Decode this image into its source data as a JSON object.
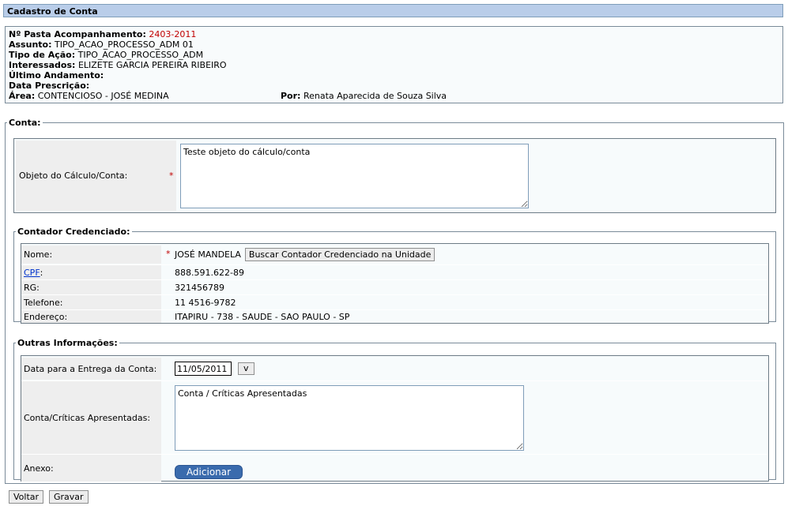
{
  "header": {
    "title": "Cadastro de Conta"
  },
  "info": {
    "pasta_label": "Nº Pasta Acompanhamento:",
    "pasta_value": "2403-2011",
    "assunto_label": "Assunto:",
    "assunto_value": "TIPO_ACAO_PROCESSO_ADM 01",
    "tipo_label": "Tipo de Ação:",
    "tipo_value": "TIPO_ACAO_PROCESSO_ADM",
    "interessados_label": "Interessados:",
    "interessados_value": "ELIZETE GARCIA PEREIRA RIBEIRO",
    "ultimo_label": "Último Andamento:",
    "prescricao_label": "Data Prescrição:",
    "area_label": "Área:",
    "area_value": "CONTENCIOSO - JOSÉ MEDINA",
    "por_label": "Por:",
    "por_value": "Renata Aparecida de Souza Silva"
  },
  "conta": {
    "legend": "Conta:",
    "objeto_label": "Objeto do Cálculo/Conta:",
    "required_mark": "*",
    "objeto_value": "Teste objeto do cálculo/conta"
  },
  "contador": {
    "legend": "Contador Credenciado:",
    "nome_label": "Nome:",
    "nome_value": "JOSÉ MANDELA",
    "buscar_button": "Buscar Contador Credenciado na Unidade",
    "cpf_label": "CPF",
    "cpf_colon": ":",
    "cpf_value": "888.591.622-89",
    "rg_label": "RG:",
    "rg_value": "321456789",
    "telefone_label": "Telefone:",
    "telefone_value": "11 4516-9782",
    "endereco_label": "Endereço:",
    "endereco_value": "ITAPIRU - 738 - SAUDE - SAO PAULO - SP"
  },
  "outras": {
    "legend": "Outras Informações:",
    "data_label": "Data para a Entrega da Conta:",
    "data_value": "11/05/2011",
    "date_button": "v",
    "criticas_label": "Conta/Críticas Apresentadas:",
    "criticas_value": "Conta / Críticas Apresentadas",
    "anexo_label": "Anexo:",
    "adicionar_button": "Adicionar"
  },
  "footer": {
    "voltar": "Voltar",
    "gravar": "Gravar"
  }
}
